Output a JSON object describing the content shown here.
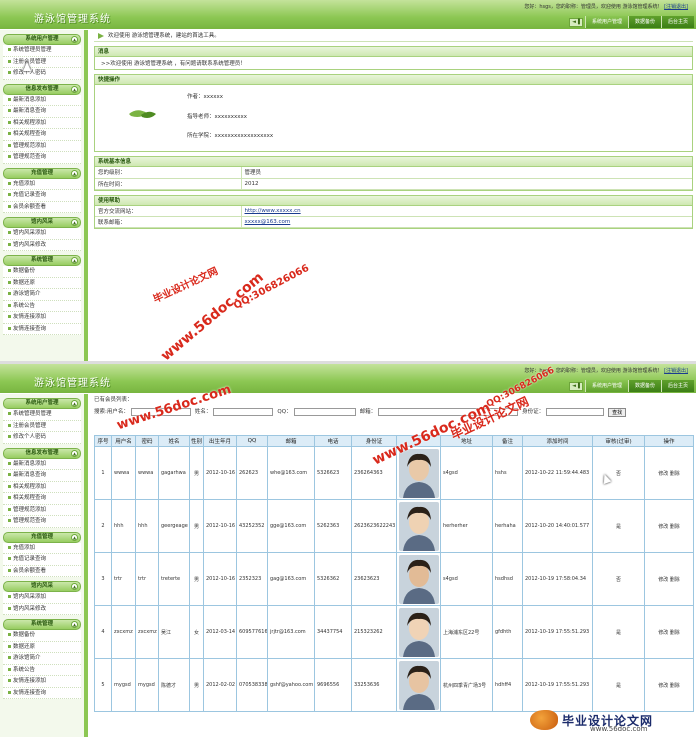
{
  "app": {
    "title": "游泳馆管理系统",
    "welcome": "您好：hsgs，您的职称：管理员，欢迎使用 游泳馆管理系统！",
    "logout": "[注销退出]"
  },
  "tabs": [
    "系统用户管理",
    "数据备份",
    "后台主页"
  ],
  "sidebar": [
    {
      "title": "系统用户管理",
      "items": [
        "系统管理员管理",
        "注册会员管理",
        "修改个人密码"
      ]
    },
    {
      "title": "信息发布管理",
      "items": [
        "最新消息添加",
        "最新消息查询",
        "相关规程添加",
        "相关规程查询",
        "管理规范添加",
        "管理规范查询"
      ]
    },
    {
      "title": "充值管理",
      "items": [
        "充值添加",
        "充值记录查询",
        "会员余额查看"
      ]
    },
    {
      "title": "馆内风采",
      "items": [
        "馆内风采添加",
        "馆内风采修改"
      ]
    },
    {
      "title": "系统管理",
      "items": [
        "数据备份",
        "数据还原",
        "游泳馆简介",
        "系统公告",
        "友情连接添加",
        "友情连接查询"
      ]
    }
  ],
  "home": {
    "breadcrumb": "欢迎使用 游泳馆管理系统，建站的首选工具。",
    "news_title": "消息",
    "news_text": ">>欢迎使用 游泳馆管理系统 ，有问题请联系系统管理员！",
    "quick_title": "快捷操作",
    "author_label": "作者：",
    "author_value": "xxxxxx",
    "teacher_label": "指导老师：",
    "teacher_value": "xxxxxxxxxx",
    "school_label": "所在学院：",
    "school_value": "xxxxxxxxxxxxxxxxxx",
    "sysinfo_title": "系统基本信息",
    "level_label": "您的级别：",
    "level_value": "管理员",
    "time_label": "所在时间：",
    "time_value": "2012",
    "help_title": "使用帮助",
    "site_label": "官方交流网站：",
    "site_value": "http://www.xxxxx.cn",
    "mail_label": "联系邮箱：",
    "mail_value": "xxxxx@163.com"
  },
  "members": {
    "caption": "已有会员列表：",
    "search": {
      "label": "搜索:",
      "user": "用户名：",
      "name": "姓名：",
      "qq": "QQ：",
      "email": "邮箱：",
      "id": "身份证：",
      "button": "查找"
    },
    "columns": [
      "序号",
      "用户名",
      "密码",
      "姓名",
      "性别",
      "出生年月",
      "QQ",
      "邮箱",
      "电话",
      "身份证",
      "",
      "地址",
      "备注",
      "添加时间",
      "审核(过审)",
      "操作"
    ],
    "rows": [
      [
        "1",
        "wwwa",
        "wwwa",
        "gagarhwa",
        "男",
        "2012-10-16",
        "262623",
        "whe@163.com",
        "5326623",
        "236264363",
        "",
        "s4gsd",
        "hshs",
        "2012-10-22 11:59:44.483",
        "否",
        "修改 删除"
      ],
      [
        "2",
        "hhh",
        "hhh",
        "geergeage",
        "男",
        "2012-10-16",
        "43252352",
        "gge@163.com",
        "5262363",
        "2623623622243",
        "",
        "herherher",
        "herhaha",
        "2012-10-20 14:40:01.577",
        "是",
        "修改 删除"
      ],
      [
        "3",
        "trtr",
        "trtr",
        "treterte",
        "男",
        "2012-10-16",
        "2352323",
        "gag@163.com",
        "5326362",
        "23623623",
        "",
        "s4gsd",
        "hsdhsd",
        "2012-10-19 17:58:04.34",
        "否",
        "修改 删除"
      ],
      [
        "4",
        "zxcxmz",
        "zxcxmz",
        "吴江",
        "女",
        "2012-03-14",
        "609577616",
        "jrjtr@163.com",
        "34437754",
        "215323262",
        "",
        "上海浦东区22号",
        "gfdhth",
        "2012-10-19 17:55:51.293",
        "是",
        "修改 删除"
      ],
      [
        "5",
        "mygsd",
        "mygsd",
        "陈德才",
        "男",
        "2012-02-02",
        "070538338",
        "gshf@yahoo.com",
        "9696556",
        "33253636",
        "",
        "杭州四季青广场3号",
        "hdhff4",
        "2012-10-19 17:55:51.293",
        "是",
        "修改 删除"
      ]
    ]
  },
  "watermarks": {
    "cn": "毕业设计论文网",
    "url": "www.56doc.com",
    "qq": "QQ:306826066"
  },
  "footer": {
    "title": "毕业设计论文网",
    "url": "www.56doc.com"
  },
  "colors": {
    "header": "#8cc753",
    "accent": "#3b7e16",
    "table_border": "#9cc6e0"
  }
}
